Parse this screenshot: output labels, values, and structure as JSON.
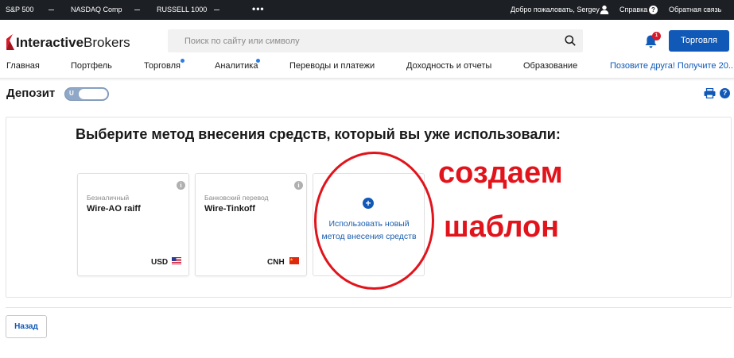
{
  "ticker": {
    "items": [
      "S&P 500",
      "NASDAQ Comp",
      "RUSSELL 1000"
    ],
    "more": "•••",
    "welcome": "Добро пожаловать, Sergey",
    "help": "Справка",
    "feedback": "Обратная связь"
  },
  "header": {
    "logo_bold": "Interactive",
    "logo_light": "Brokers",
    "search_placeholder": "Поиск по сайту или символу",
    "notification_count": "1",
    "trade_button": "Торговля"
  },
  "nav": {
    "items": [
      "Главная",
      "Портфель",
      "Торговля",
      "Аналитика",
      "Переводы и платежи",
      "Доходность и отчеты",
      "Образование"
    ],
    "invite": "Позовите друга! Получите 20..."
  },
  "page": {
    "title": "Депозит",
    "toggle_label": "U",
    "heading": "Выберите метод внесения средств, который вы уже использовали:"
  },
  "cards": [
    {
      "type": "Безналичный",
      "name": "Wire-AO raiff",
      "currency": "USD",
      "flag": "us-flag-icon"
    },
    {
      "type": "Банковский перевод",
      "name": "Wire-Tinkoff",
      "currency": "CNH",
      "flag": "cn-flag-icon"
    }
  ],
  "new_method": {
    "icon": "plus-icon",
    "label": "Использовать новый метод внесения средств"
  },
  "annotation": {
    "line1": "создаем",
    "line2": "шаблон",
    "color": "#e1141c"
  },
  "footer": {
    "back_button": "Назад"
  },
  "colors": {
    "brand_blue": "#1059b7",
    "ticker_bg": "#1c1f24",
    "logo_red": "#d81b2a"
  }
}
